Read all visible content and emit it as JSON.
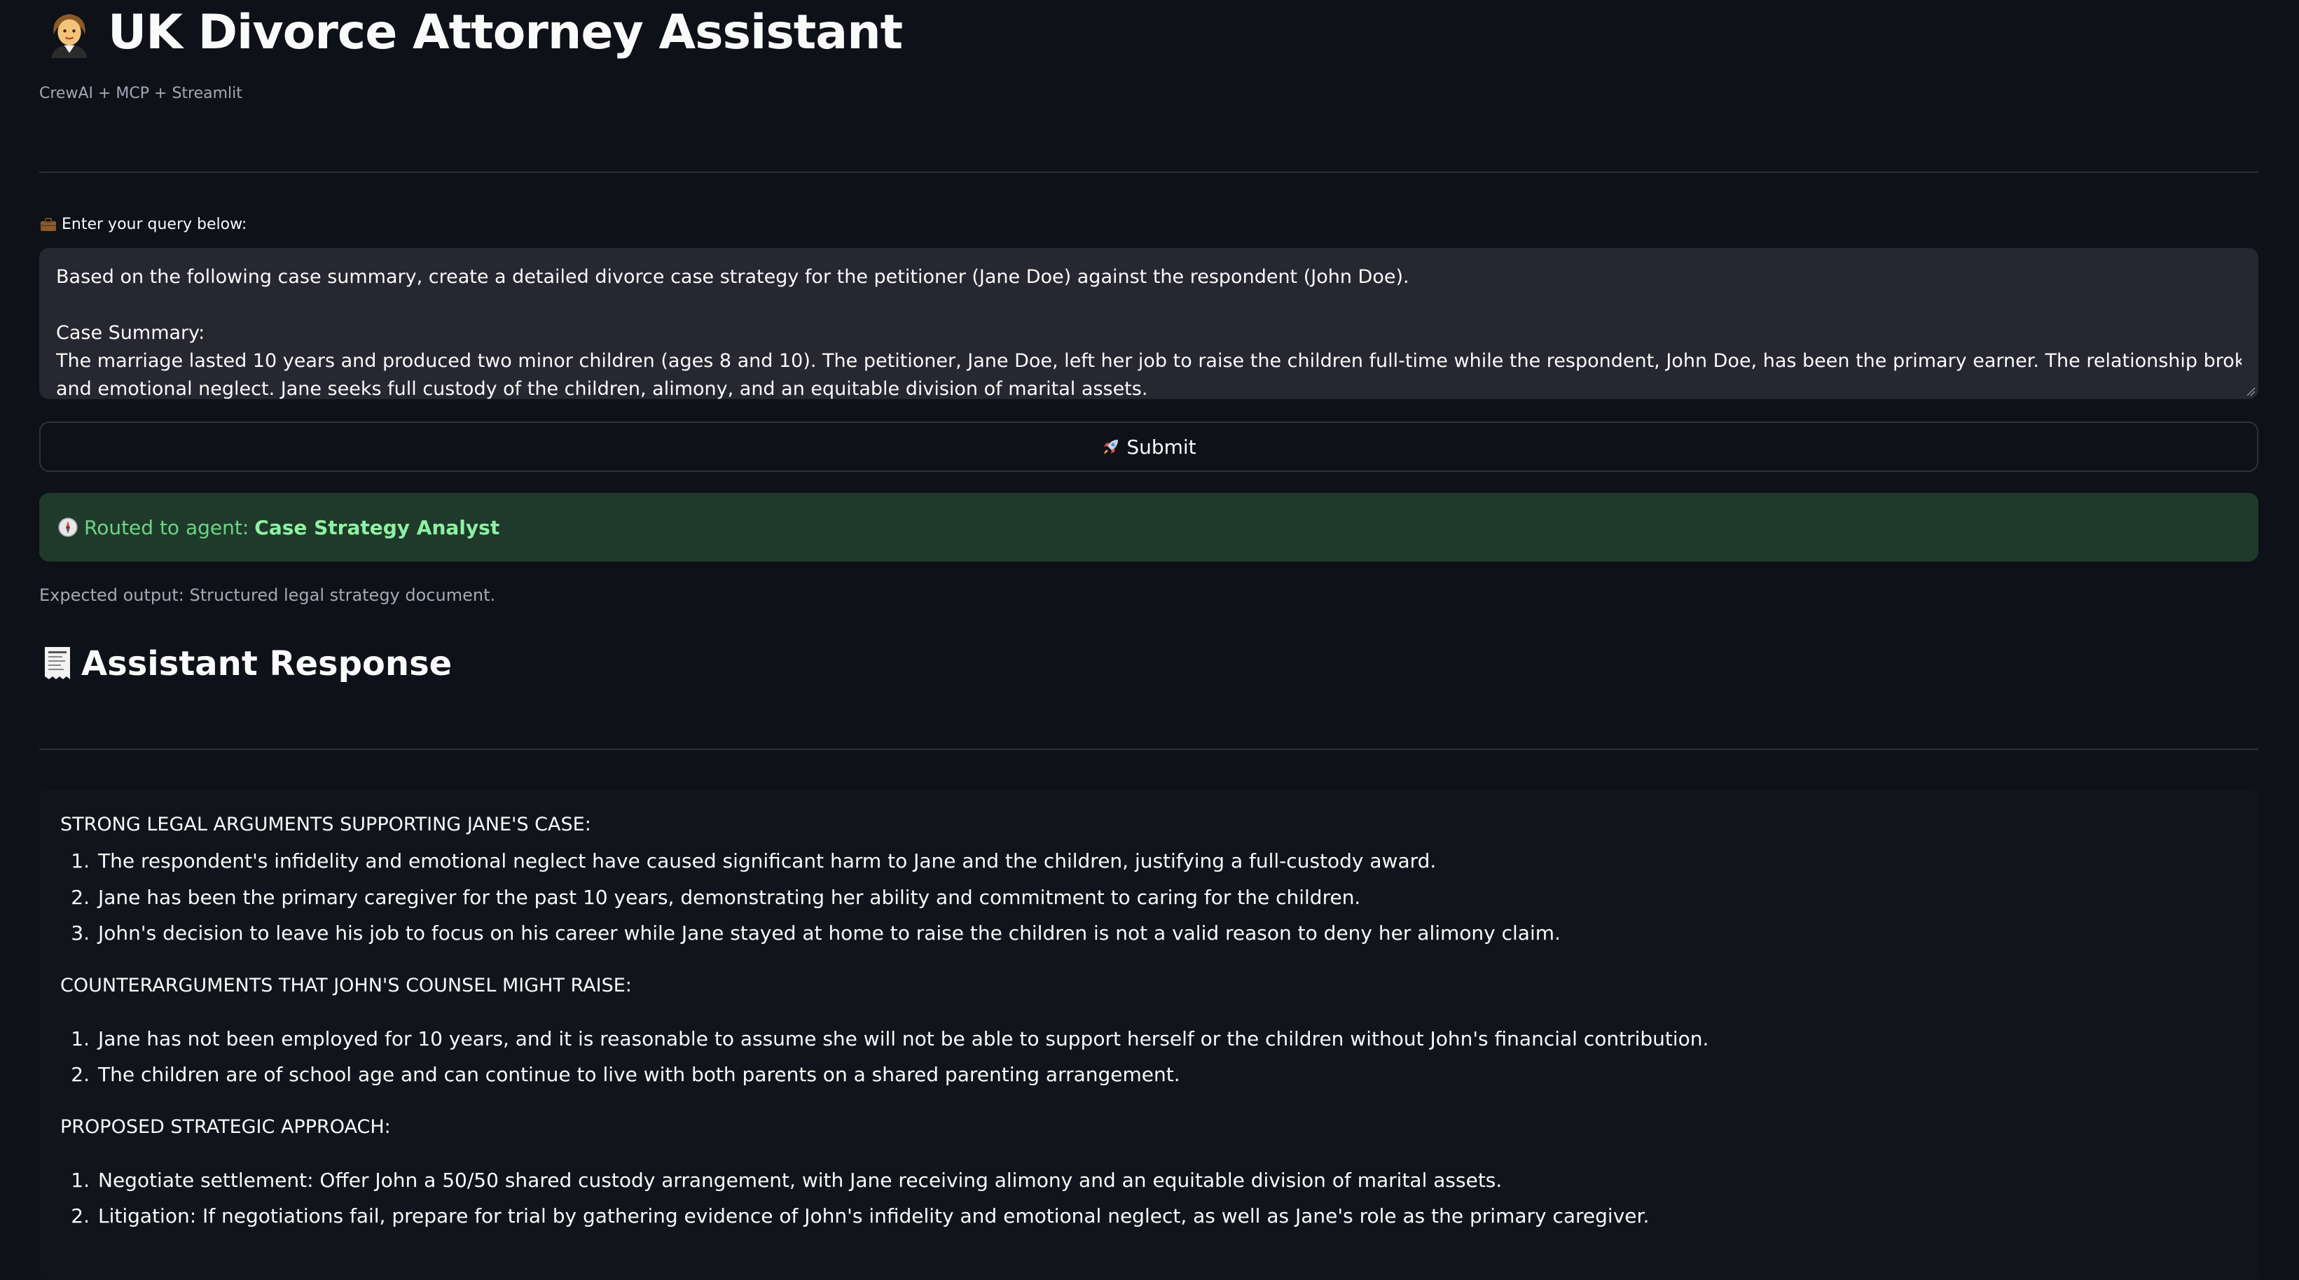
{
  "header": {
    "title_icon": "woman-judge-emoji-icon",
    "title": "UK Divorce Attorney Assistant",
    "caption": "CrewAI + MCP + Streamlit"
  },
  "query": {
    "label_icon": "briefcase-icon",
    "label": "Enter your query below:",
    "lines": [
      "Based on the following case summary, create a detailed divorce case strategy for the petitioner (Jane Doe) against the respondent (John Doe).",
      "",
      "Case Summary:",
      "The marriage lasted 10 years and produced two minor children (ages 8 and 10). The petitioner, Jane Doe, left her job to raise the children full-time while the respondent, John Doe, has been the primary earner. The relationship broke down due to John’s infidelity",
      "and emotional neglect. Jane seeks full custody of the children, alimony, and an equitable division of marital assets."
    ]
  },
  "submit": {
    "icon": "rocket-icon",
    "label": "Submit"
  },
  "routing": {
    "icon": "compass-icon",
    "prefix": "Routed to agent:",
    "agent": "Case Strategy Analyst"
  },
  "expected_output": "Expected output: Structured legal strategy document.",
  "response": {
    "title_icon": "receipt-icon",
    "title": "Assistant Response",
    "sections": [
      {
        "heading": "STRONG LEGAL ARGUMENTS SUPPORTING JANE'S CASE:",
        "items": [
          "The respondent's infidelity and emotional neglect have caused significant harm to Jane and the children, justifying a full-custody award.",
          "Jane has been the primary caregiver for the past 10 years, demonstrating her ability and commitment to caring for the children.",
          "John's decision to leave his job to focus on his career while Jane stayed at home to raise the children is not a valid reason to deny her alimony claim."
        ]
      },
      {
        "heading": "COUNTERARGUMENTS THAT JOHN'S COUNSEL MIGHT RAISE:",
        "items": [
          "Jane has not been employed for 10 years, and it is reasonable to assume she will not be able to support herself or the children without John's financial contribution.",
          "The children are of school age and can continue to live with both parents on a shared parenting arrangement."
        ]
      },
      {
        "heading": "PROPOSED STRATEGIC APPROACH:",
        "items": [
          "Negotiate settlement: Offer John a 50/50 shared custody arrangement, with Jane receiving alimony and an equitable division of marital assets.",
          "Litigation: If negotiations fail, prepare for trial by gathering evidence of John's infidelity and emotional neglect, as well as Jane's role as the primary caregiver."
        ]
      }
    ]
  },
  "colors": {
    "background": "#0e1117",
    "input_bg": "#262730",
    "success_bg": "#1f3a2a",
    "success_text": "#6fd487"
  }
}
